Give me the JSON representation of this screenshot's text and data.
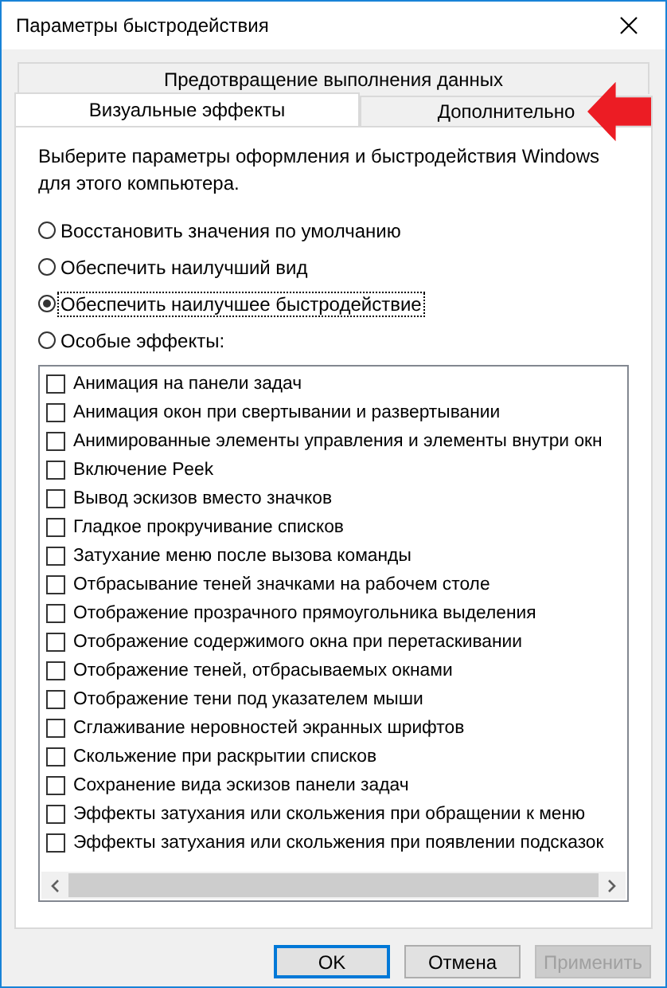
{
  "window": {
    "title": "Параметры быстродействия"
  },
  "tab_rows": [
    [
      {
        "label": "Предотвращение выполнения данных",
        "selected": false
      }
    ],
    [
      {
        "label": "Визуальные эффекты",
        "selected": true
      },
      {
        "label": "Дополнительно",
        "selected": false
      }
    ]
  ],
  "description": "Выберите параметры оформления и быстродействия Windows для этого компьютера.",
  "options": [
    {
      "label": "Восстановить значения по умолчанию",
      "selected": false
    },
    {
      "label": "Обеспечить наилучший вид",
      "selected": false
    },
    {
      "label": "Обеспечить наилучшее быстродействие",
      "selected": true
    },
    {
      "label": "Особые эффекты:",
      "selected": false
    }
  ],
  "effects": [
    {
      "label": "Анимация на панели задач",
      "checked": false
    },
    {
      "label": "Анимация окон при свертывании и развертывании",
      "checked": false
    },
    {
      "label": "Анимированные элементы управления и элементы внутри окн",
      "checked": false
    },
    {
      "label": "Включение Peek",
      "checked": false
    },
    {
      "label": "Вывод эскизов вместо значков",
      "checked": false
    },
    {
      "label": "Гладкое прокручивание списков",
      "checked": false
    },
    {
      "label": "Затухание меню после вызова команды",
      "checked": false
    },
    {
      "label": "Отбрасывание теней значками на рабочем столе",
      "checked": false
    },
    {
      "label": "Отображение прозрачного прямоугольника выделения",
      "checked": false
    },
    {
      "label": "Отображение содержимого окна при перетаскивании",
      "checked": false
    },
    {
      "label": "Отображение теней, отбрасываемых окнами",
      "checked": false
    },
    {
      "label": "Отображение тени под указателем мыши",
      "checked": false
    },
    {
      "label": "Сглаживание неровностей экранных шрифтов",
      "checked": false
    },
    {
      "label": "Скольжение при раскрытии списков",
      "checked": false
    },
    {
      "label": "Сохранение вида эскизов панели задач",
      "checked": false
    },
    {
      "label": "Эффекты затухания или скольжения при обращении к меню",
      "checked": false
    },
    {
      "label": "Эффекты затухания или скольжения при появлении подсказок",
      "checked": false
    }
  ],
  "buttons": [
    {
      "label": "OK",
      "default": true,
      "disabled": false
    },
    {
      "label": "Отмена",
      "default": false,
      "disabled": false
    },
    {
      "label": "Применить",
      "default": false,
      "disabled": true
    }
  ]
}
